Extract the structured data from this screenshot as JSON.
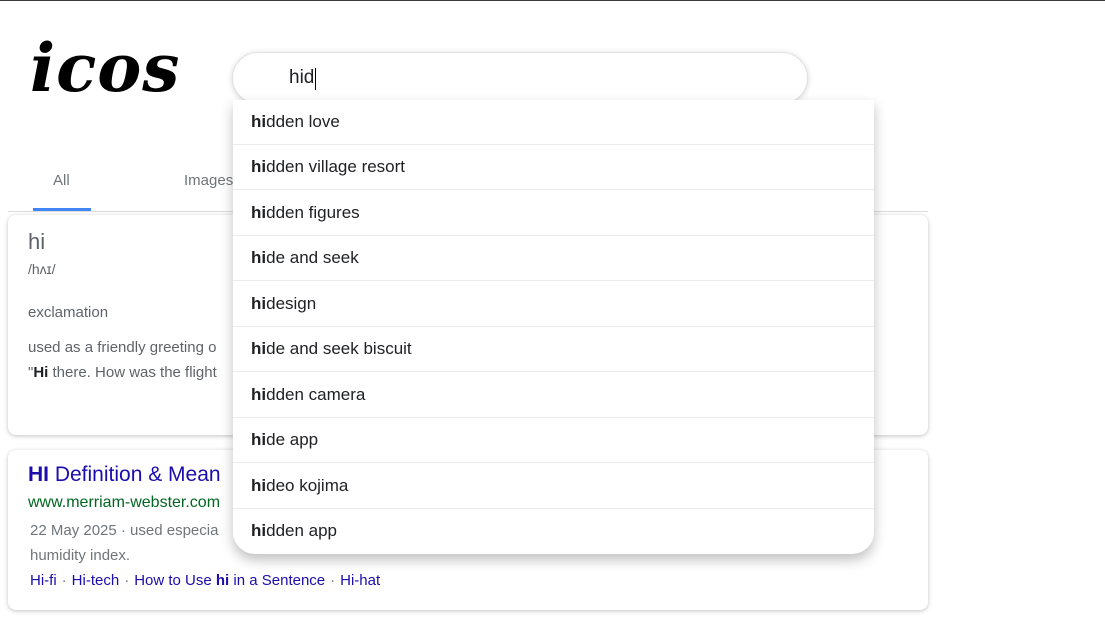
{
  "logo": "icos",
  "search": {
    "query": "hid",
    "suggestions": [
      {
        "bold": "hi",
        "rest": "dden love"
      },
      {
        "bold": "hi",
        "rest": "dden village resort"
      },
      {
        "bold": "hi",
        "rest": "dden figures"
      },
      {
        "bold": "hi",
        "rest": "de and seek"
      },
      {
        "bold": "hi",
        "rest": "design"
      },
      {
        "bold": "hi",
        "rest": "de and seek biscuit"
      },
      {
        "bold": "hi",
        "rest": "dden camera"
      },
      {
        "bold": "hi",
        "rest": "de app"
      },
      {
        "bold": "hi",
        "rest": "deo kojima"
      },
      {
        "bold": "hi",
        "rest": "dden app"
      }
    ]
  },
  "tabs": {
    "all": "All",
    "images": "Images"
  },
  "dictionary": {
    "word": "hi",
    "phonetic": "/hʌɪ/",
    "part_of_speech": "exclamation",
    "definition": "used as a friendly greeting o",
    "example_open_quote": "\"",
    "example_bold": "Hi",
    "example_rest": " there. How was the flight"
  },
  "result": {
    "title_bold": "HI",
    "title_rest": " Definition & Mean",
    "url": "www.merriam-webster.com",
    "snippet_line1": "22 May 2025 · used especia",
    "snippet_line2": "humidity index.",
    "links": {
      "hifi": "Hi-fi",
      "hitech": "Hi-tech",
      "howto_prefix": "How to Use ",
      "howto_bold": "hi",
      "howto_suffix": " in a Sentence",
      "hihat": "Hi-hat",
      "separator": "·"
    }
  },
  "colors": {
    "accent_blue": "#4285f4",
    "link_blue": "#1a0dab",
    "url_green": "#006621"
  }
}
